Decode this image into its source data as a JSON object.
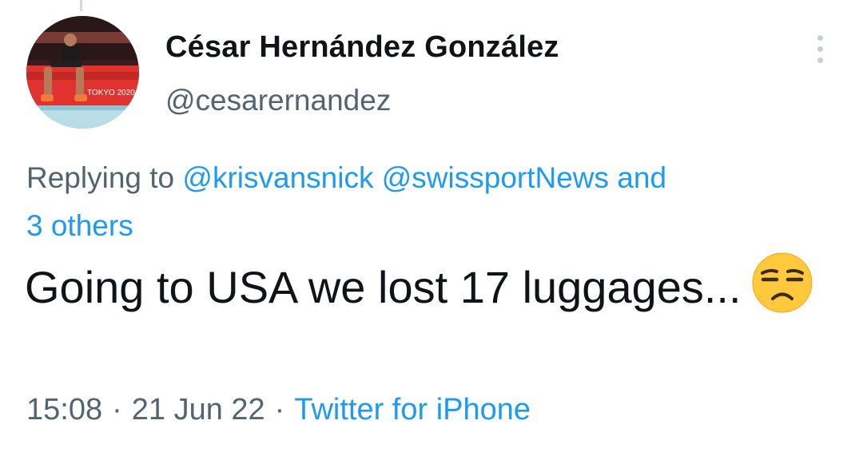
{
  "tweet": {
    "author_name": "César Hernández González",
    "author_handle": "@cesarernandez",
    "avatar_caption": "TOKYO 2020",
    "replying_prefix": "Replying to ",
    "mentions": [
      "@krisvansnick",
      "@swissportNews"
    ],
    "replying_connector": "and",
    "replying_others": "3 others",
    "text": "Going to USA we lost 17 luggages...",
    "emoji": "unamused-face",
    "time": "15:08",
    "separator": "·",
    "date": "21 Jun 22",
    "source": "Twitter for iPhone"
  },
  "colors": {
    "text_primary": "#0f1419",
    "text_secondary": "#536471",
    "link": "#1d9bf0",
    "more_dots": "#c4cfd6",
    "emoji_yellow": "#ffc83d"
  },
  "icons": {
    "more": "more-vertical-icon",
    "emoji": "unamused-face-emoji"
  }
}
